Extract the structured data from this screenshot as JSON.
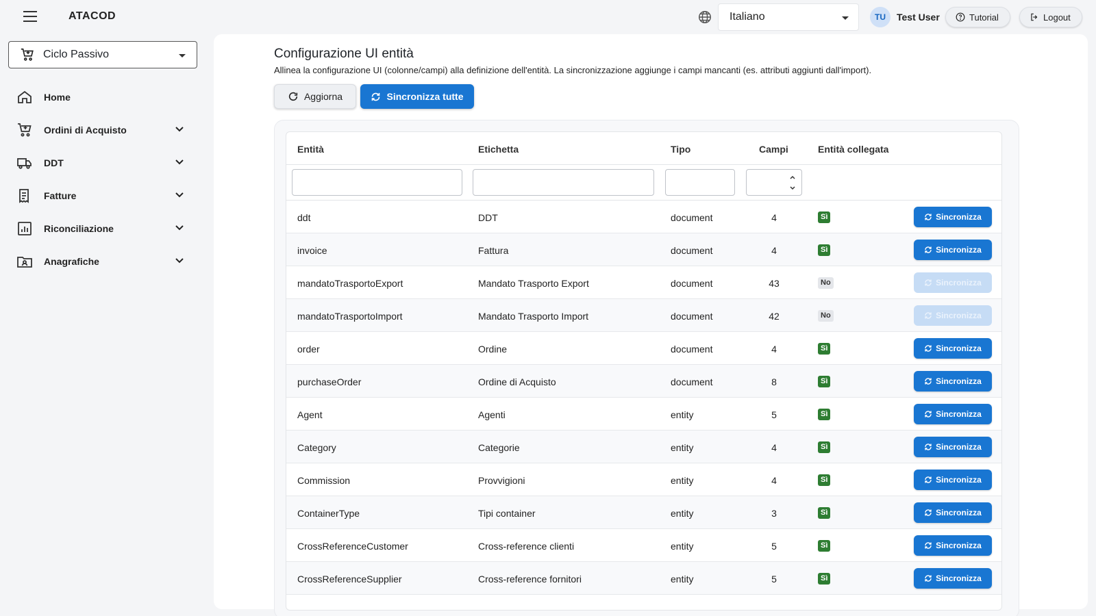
{
  "app": {
    "brand": "ATACOD"
  },
  "topbar": {
    "language": "Italiano",
    "avatar_initials": "TU",
    "user_name": "Test User",
    "tutorial_label": "Tutorial",
    "logout_label": "Logout"
  },
  "sidebar": {
    "module": "Ciclo Passivo",
    "items": [
      {
        "label": "Home",
        "icon": "home-icon",
        "expandable": false
      },
      {
        "label": "Ordini di Acquisto",
        "icon": "cart-icon",
        "expandable": true
      },
      {
        "label": "DDT",
        "icon": "truck-icon",
        "expandable": true
      },
      {
        "label": "Fatture",
        "icon": "receipt-icon",
        "expandable": true
      },
      {
        "label": "Riconciliazione",
        "icon": "chart-icon",
        "expandable": true
      },
      {
        "label": "Anagrafiche",
        "icon": "folder-user-icon",
        "expandable": true
      }
    ]
  },
  "page": {
    "title": "Configurazione UI entità",
    "description": "Allinea la configurazione UI (colonne/campi) alla definizione dell'entità. La sincronizzazione aggiunge i campi mancanti (es. attributi aggiunti dall'import).",
    "refresh_label": "Aggiorna",
    "sync_all_label": "Sincronizza tutte"
  },
  "table": {
    "columns": [
      "Entità",
      "Etichetta",
      "Tipo",
      "Campi",
      "Entità collegata"
    ],
    "sync_label": "Sincronizza",
    "rows": [
      {
        "entity": "ddt",
        "label": "DDT",
        "type": "document",
        "fields": "4",
        "linked": "Sì",
        "linked_flag": true
      },
      {
        "entity": "invoice",
        "label": "Fattura",
        "type": "document",
        "fields": "4",
        "linked": "Sì",
        "linked_flag": true
      },
      {
        "entity": "mandatoTrasportoExport",
        "label": "Mandato Trasporto Export",
        "type": "document",
        "fields": "43",
        "linked": "No",
        "linked_flag": false
      },
      {
        "entity": "mandatoTrasportoImport",
        "label": "Mandato Trasporto Import",
        "type": "document",
        "fields": "42",
        "linked": "No",
        "linked_flag": false
      },
      {
        "entity": "order",
        "label": "Ordine",
        "type": "document",
        "fields": "4",
        "linked": "Sì",
        "linked_flag": true
      },
      {
        "entity": "purchaseOrder",
        "label": "Ordine di Acquisto",
        "type": "document",
        "fields": "8",
        "linked": "Sì",
        "linked_flag": true
      },
      {
        "entity": "Agent",
        "label": "Agenti",
        "type": "entity",
        "fields": "5",
        "linked": "Sì",
        "linked_flag": true
      },
      {
        "entity": "Category",
        "label": "Categorie",
        "type": "entity",
        "fields": "4",
        "linked": "Sì",
        "linked_flag": true
      },
      {
        "entity": "Commission",
        "label": "Provvigioni",
        "type": "entity",
        "fields": "4",
        "linked": "Sì",
        "linked_flag": true
      },
      {
        "entity": "ContainerType",
        "label": "Tipi container",
        "type": "entity",
        "fields": "3",
        "linked": "Sì",
        "linked_flag": true
      },
      {
        "entity": "CrossReferenceCustomer",
        "label": "Cross-reference clienti",
        "type": "entity",
        "fields": "5",
        "linked": "Sì",
        "linked_flag": true
      },
      {
        "entity": "CrossReferenceSupplier",
        "label": "Cross-reference fornitori",
        "type": "entity",
        "fields": "5",
        "linked": "Sì",
        "linked_flag": true
      }
    ]
  },
  "colors": {
    "primary": "#1976d2",
    "primary_disabled": "#c6dcf5",
    "badge_yes": "#2e7d32",
    "badge_no": "#e4e6ea"
  }
}
